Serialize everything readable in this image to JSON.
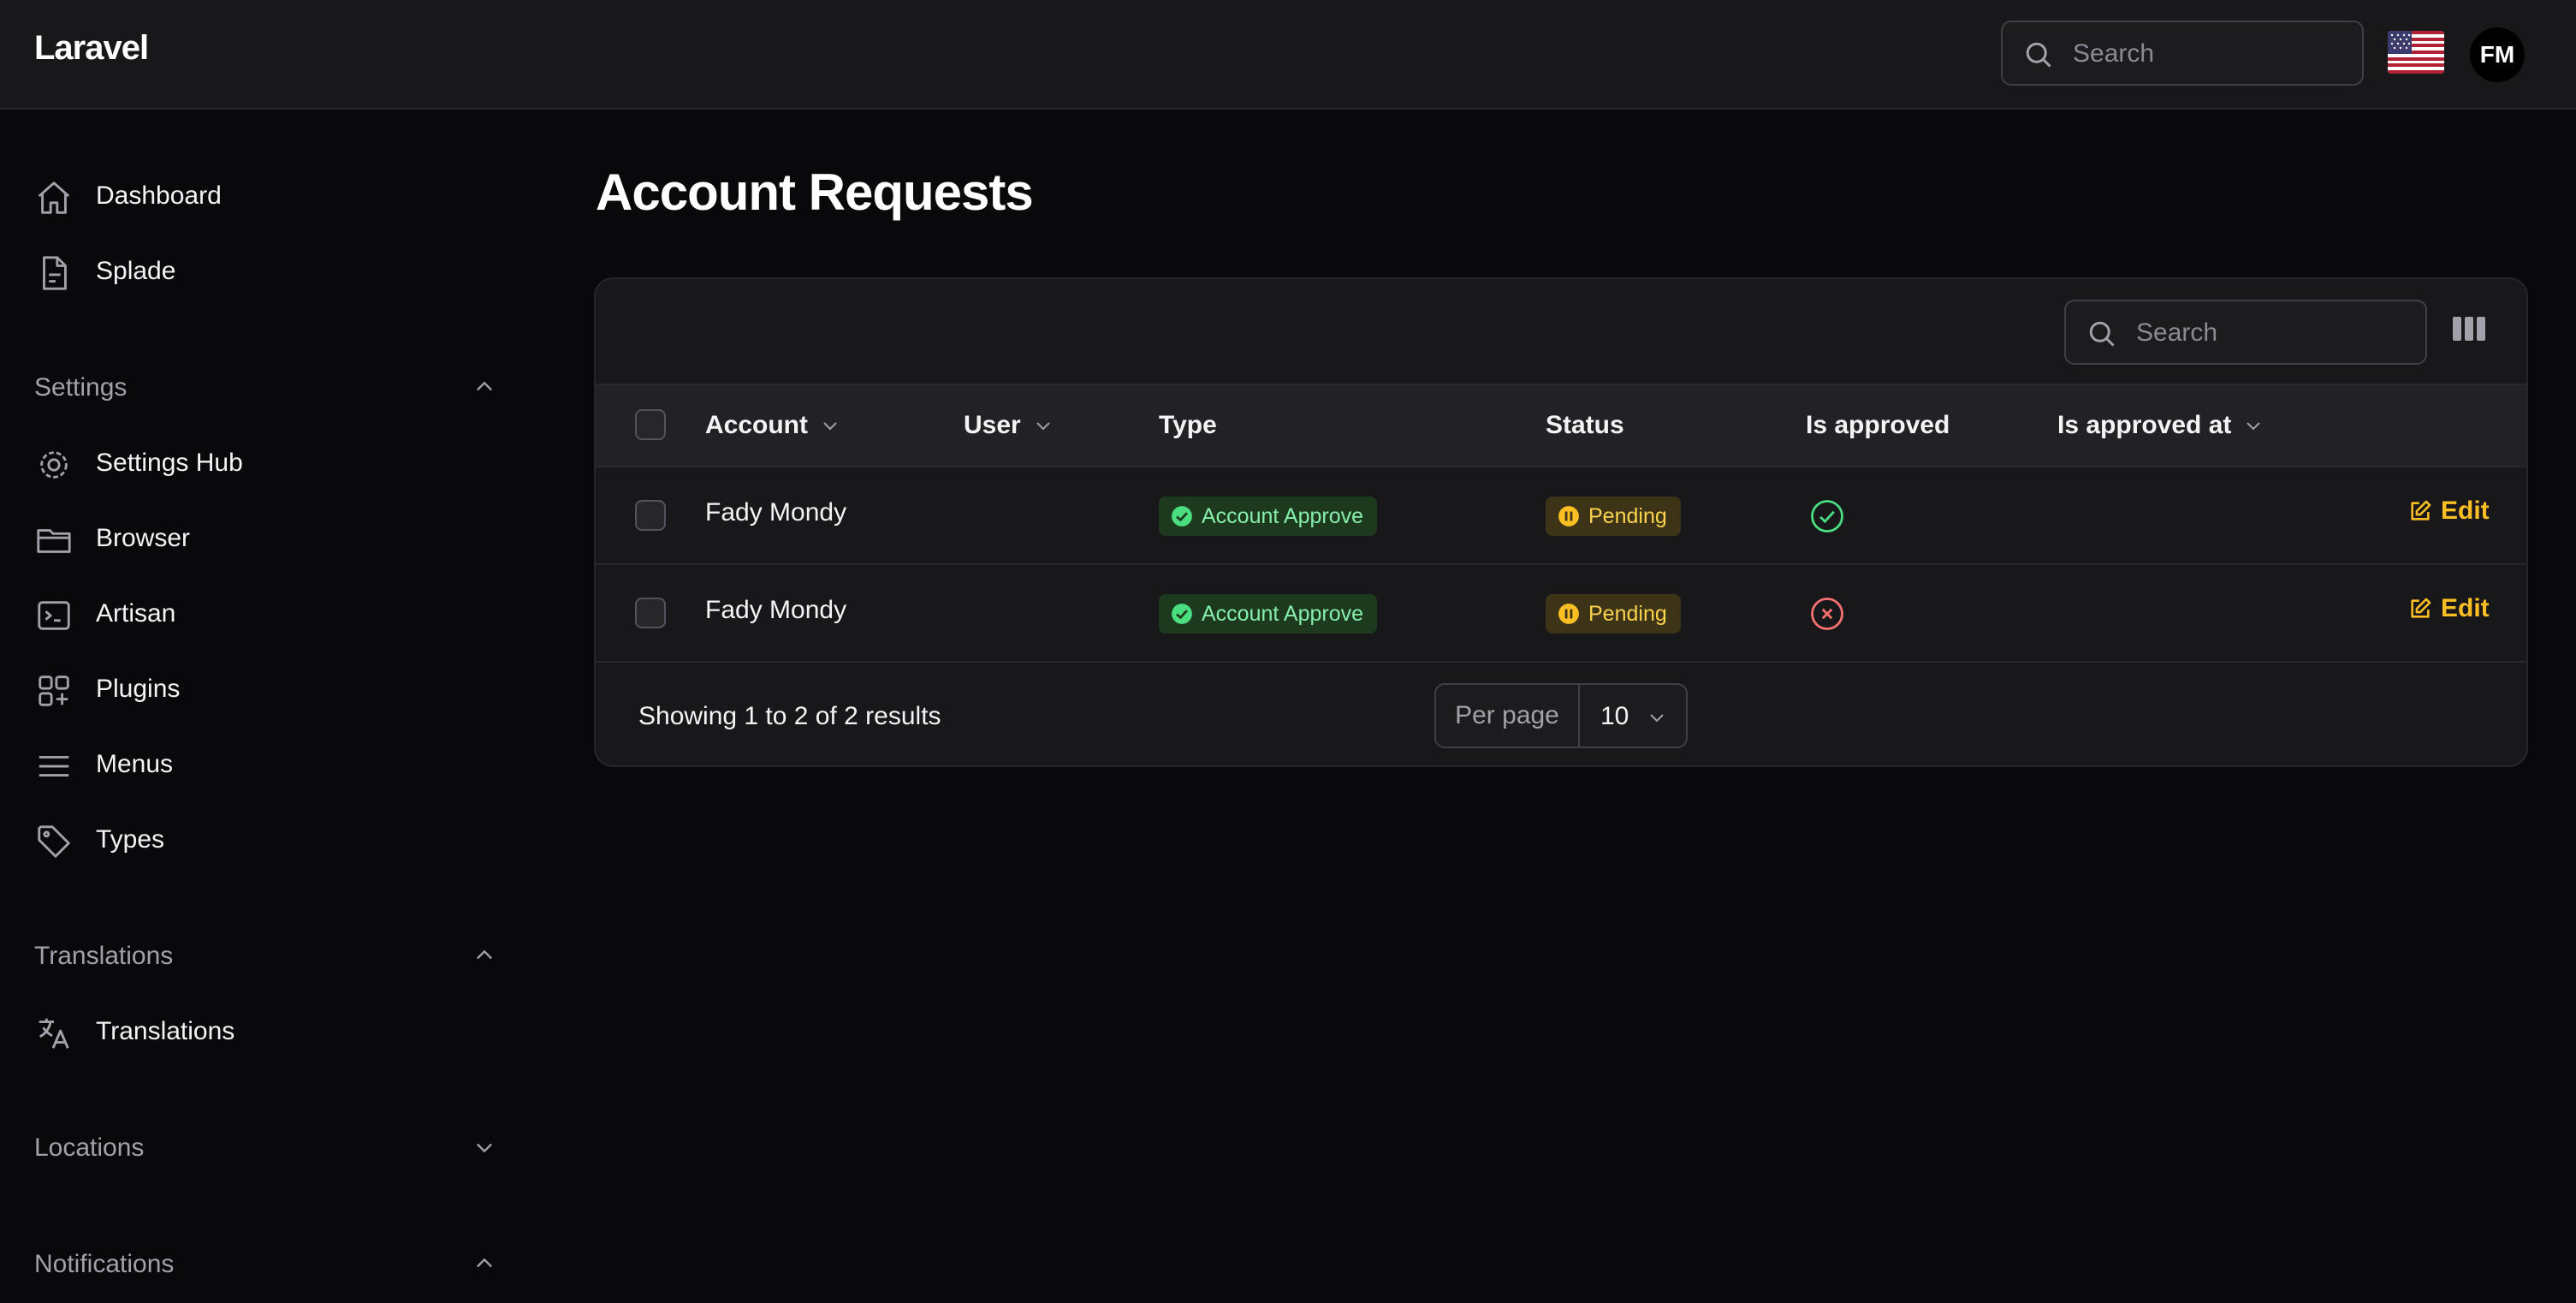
{
  "header": {
    "brand": "Laravel",
    "search_placeholder": "Search",
    "avatar_initials": "FM",
    "flag": "us-flag"
  },
  "sidebar": {
    "items": [
      {
        "label": "Dashboard",
        "icon": "home-icon"
      },
      {
        "label": "Splade",
        "icon": "document-icon"
      }
    ],
    "sections": [
      {
        "label": "Settings",
        "expanded": true,
        "items": [
          {
            "label": "Settings Hub",
            "icon": "gear-icon"
          },
          {
            "label": "Browser",
            "icon": "folder-icon"
          },
          {
            "label": "Artisan",
            "icon": "terminal-icon"
          },
          {
            "label": "Plugins",
            "icon": "plugins-icon"
          },
          {
            "label": "Menus",
            "icon": "menu-icon"
          },
          {
            "label": "Types",
            "icon": "tag-icon"
          }
        ]
      },
      {
        "label": "Translations",
        "expanded": true,
        "items": [
          {
            "label": "Translations",
            "icon": "language-icon"
          }
        ]
      },
      {
        "label": "Locations",
        "expanded": false,
        "items": []
      },
      {
        "label": "Notifications",
        "expanded": true,
        "items": []
      }
    ]
  },
  "main": {
    "title": "Account Requests",
    "table": {
      "search_placeholder": "Search",
      "columns": [
        "Account",
        "User",
        "Type",
        "Status",
        "Is approved",
        "Is approved at"
      ],
      "rows": [
        {
          "account": "Fady Mondy",
          "user": "",
          "type": "Account Approve",
          "status": "Pending",
          "is_approved": true,
          "approved_at": "",
          "action": "Edit"
        },
        {
          "account": "Fady Mondy",
          "user": "",
          "type": "Account Approve",
          "status": "Pending",
          "is_approved": false,
          "approved_at": "",
          "action": "Edit"
        }
      ],
      "footer_text": "Showing 1 to 2 of 2 results",
      "per_page_label": "Per page",
      "per_page_value": "10"
    }
  },
  "colors": {
    "background": "#09090b",
    "surface": "#18181b",
    "accent": "#fbbf24",
    "success": "#4ade80",
    "danger": "#f87171"
  }
}
